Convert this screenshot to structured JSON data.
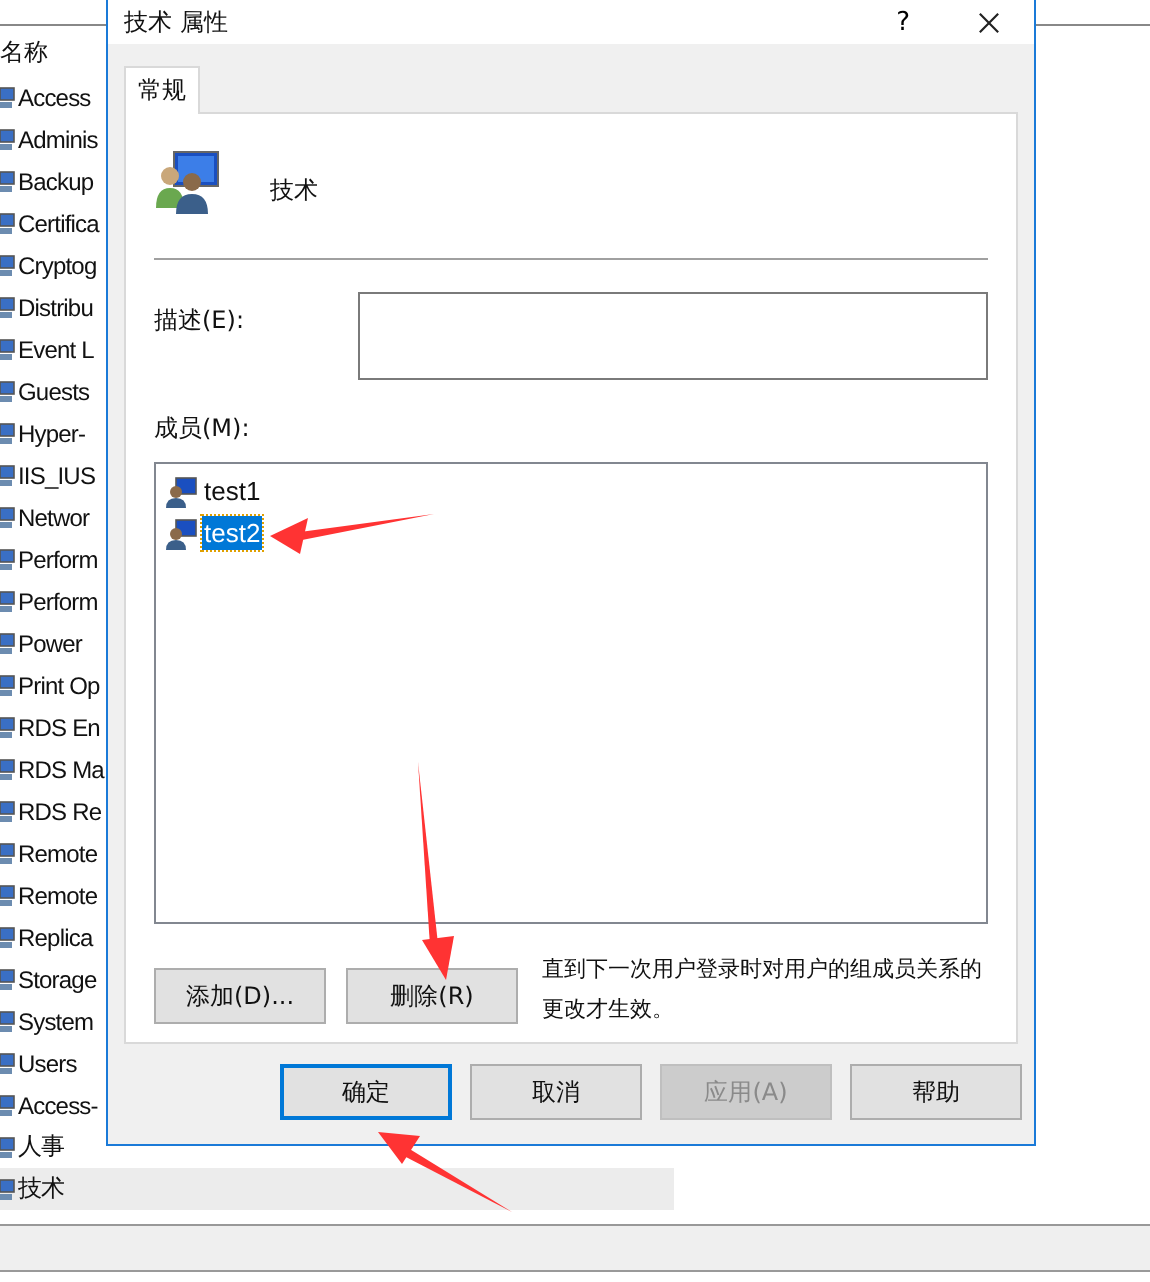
{
  "background_window": {
    "column_header": "名称",
    "groups": [
      {
        "name": "Access",
        "selected": false
      },
      {
        "name": "Adminis",
        "selected": false
      },
      {
        "name": "Backup",
        "selected": false
      },
      {
        "name": "Certifica",
        "selected": false
      },
      {
        "name": "Cryptog",
        "selected": false
      },
      {
        "name": "Distribu",
        "selected": false
      },
      {
        "name": "Event L",
        "selected": false
      },
      {
        "name": "Guests",
        "selected": false
      },
      {
        "name": "Hyper-",
        "selected": false
      },
      {
        "name": "IIS_IUS",
        "selected": false
      },
      {
        "name": "Networ",
        "selected": false
      },
      {
        "name": "Perform",
        "selected": false
      },
      {
        "name": "Perform",
        "selected": false
      },
      {
        "name": "Power",
        "selected": false
      },
      {
        "name": "Print Op",
        "selected": false
      },
      {
        "name": "RDS En",
        "selected": false
      },
      {
        "name": "RDS Ma",
        "selected": false
      },
      {
        "name": "RDS Re",
        "selected": false
      },
      {
        "name": "Remote",
        "selected": false
      },
      {
        "name": "Remote",
        "selected": false
      },
      {
        "name": "Replica",
        "selected": false
      },
      {
        "name": "Storage",
        "selected": false
      },
      {
        "name": "System",
        "selected": false
      },
      {
        "name": "Users",
        "selected": false
      },
      {
        "name": "Access-",
        "selected": false
      },
      {
        "name": "人事",
        "selected": false
      },
      {
        "name": "技术",
        "selected": true
      }
    ]
  },
  "dialog": {
    "title": "技术 属性",
    "help_button": "?",
    "tabs": [
      {
        "label": "常规",
        "selected": true
      }
    ],
    "group_name": "技术",
    "description_label": "描述(E):",
    "members_label": "成员(M):",
    "members": [
      {
        "name": "test1",
        "selected": false
      },
      {
        "name": "test2",
        "selected": true
      }
    ],
    "member_buttons": [
      {
        "label": "添加(D)...",
        "disabled": false
      },
      {
        "label": "删除(R)",
        "disabled": false
      }
    ],
    "note": "直到下一次用户登录时对用户的组成员关系的更改才生效。",
    "buttons": [
      {
        "label": "确定",
        "default": true,
        "disabled": false
      },
      {
        "label": "取消",
        "default": false,
        "disabled": false
      },
      {
        "label": "应用(A)",
        "default": false,
        "disabled": true
      },
      {
        "label": "帮助",
        "default": false,
        "disabled": false
      }
    ]
  }
}
